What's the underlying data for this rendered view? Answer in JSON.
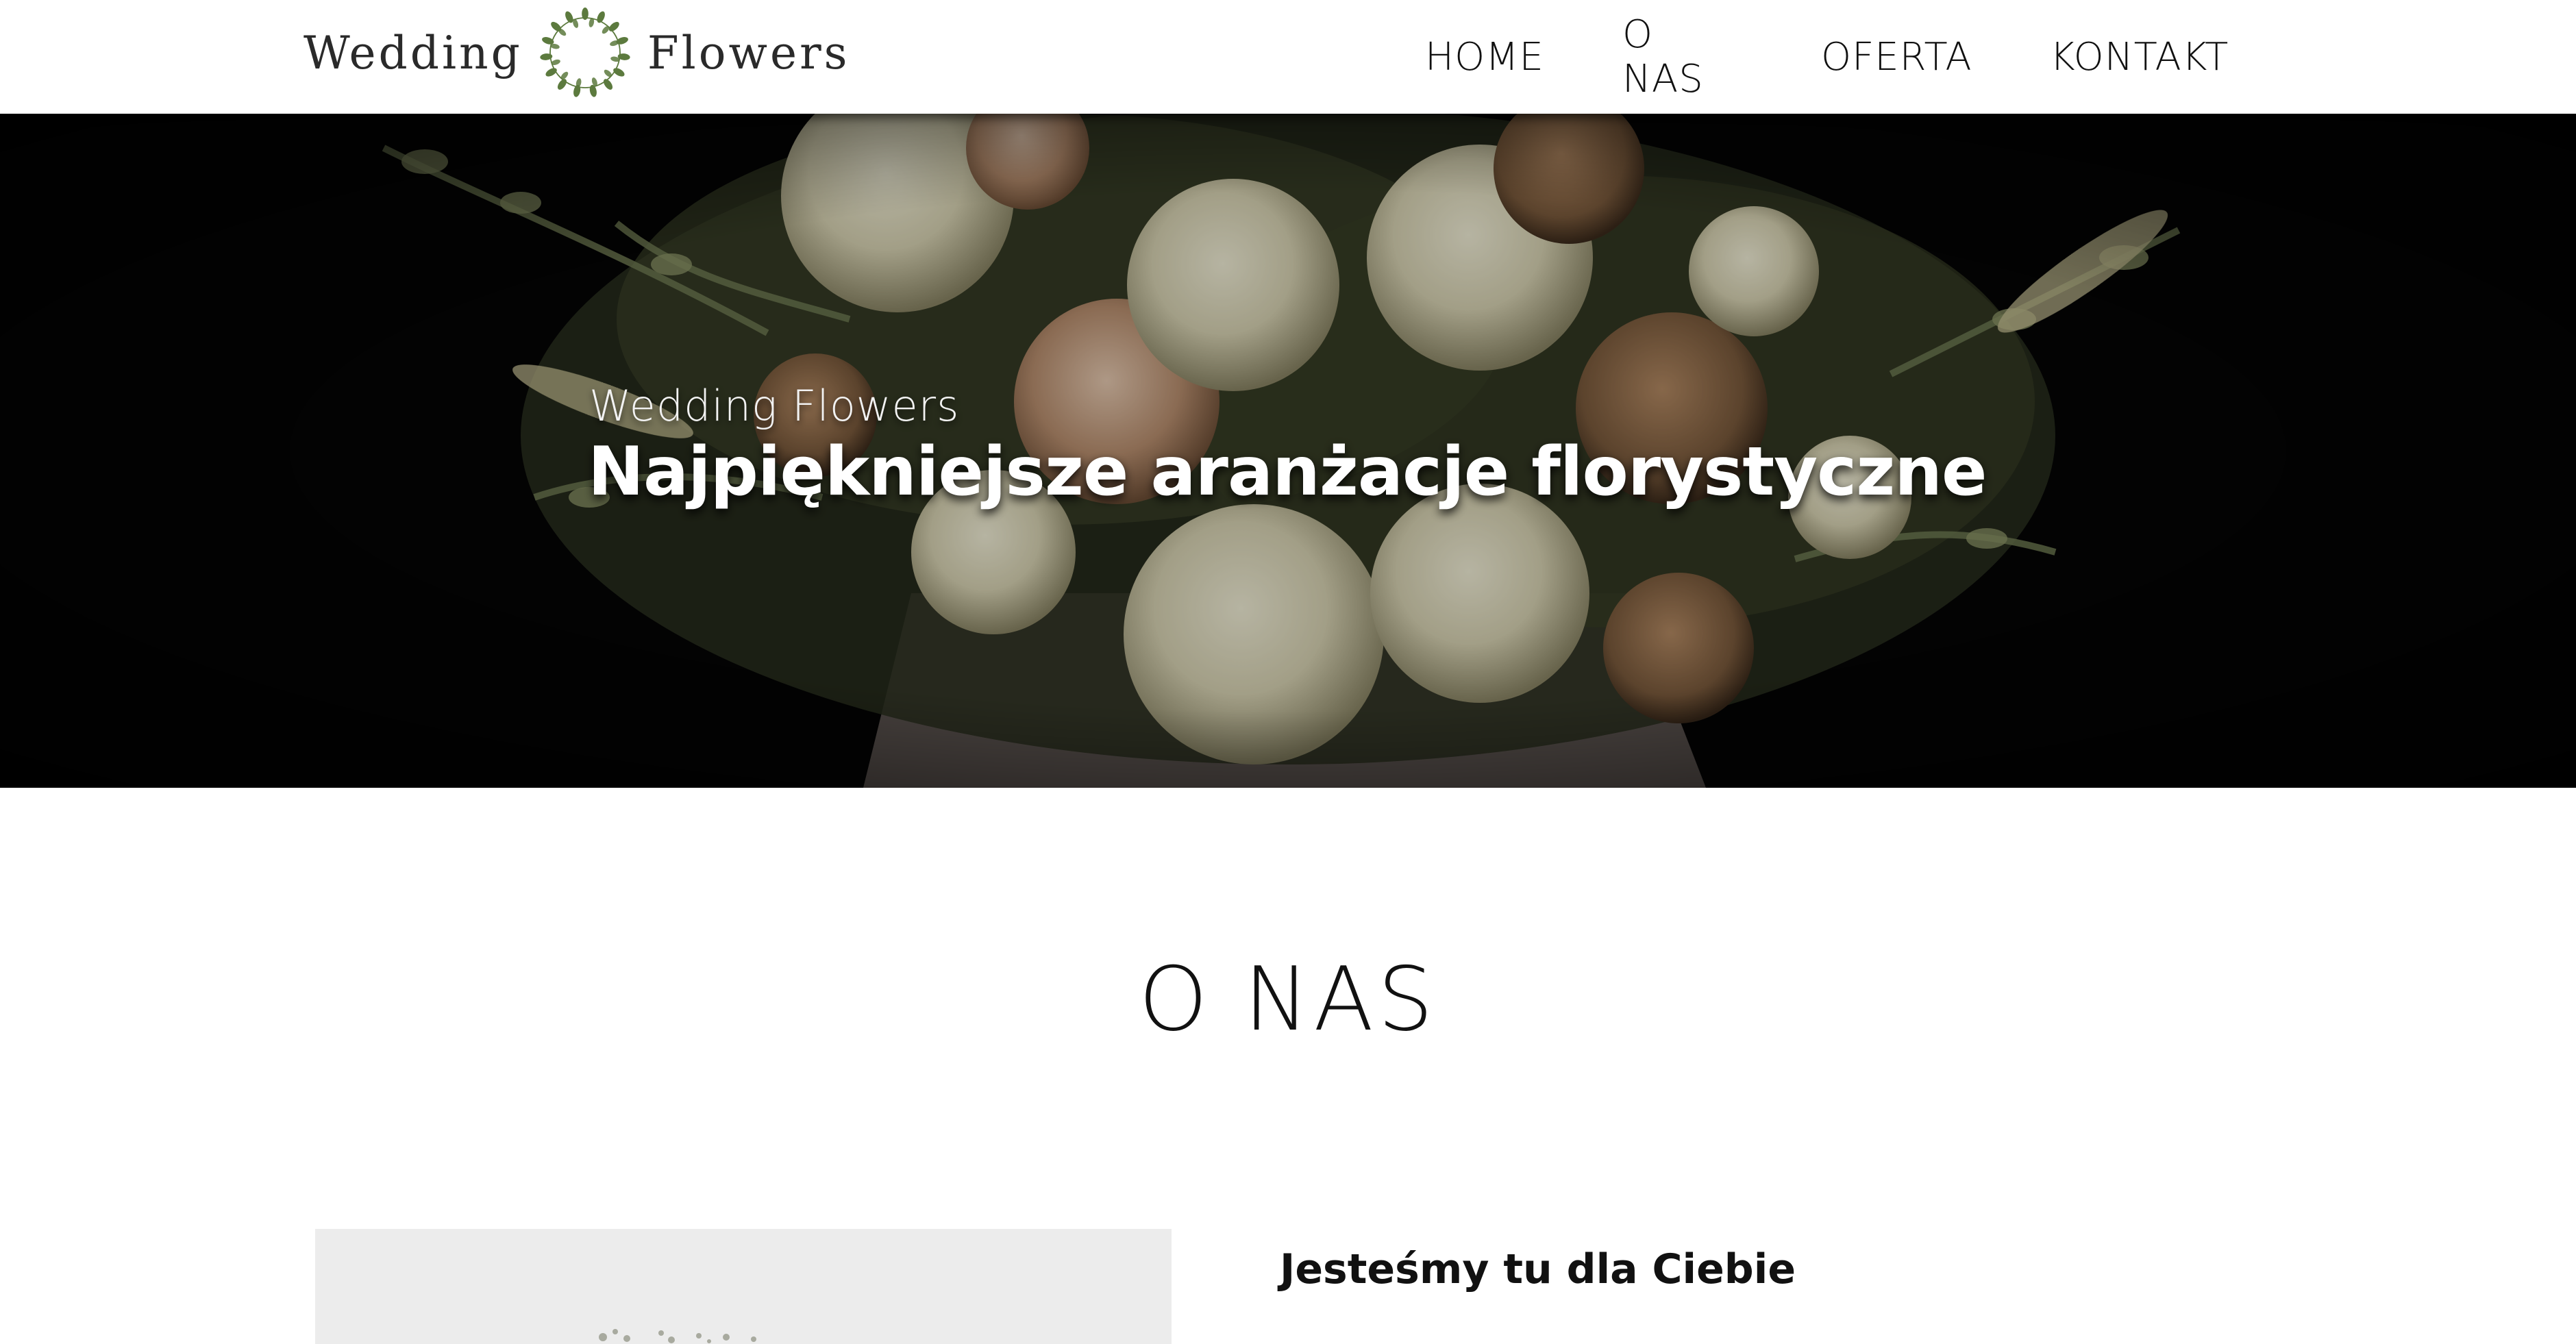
{
  "header": {
    "logo": {
      "word_left": "Wedding",
      "word_right": "Flowers"
    },
    "nav": [
      {
        "label": "HOME"
      },
      {
        "label": "O NAS"
      },
      {
        "label": "OFERTA"
      },
      {
        "label": "KONTAKT"
      }
    ]
  },
  "hero": {
    "eyebrow": "Wedding Flowers",
    "title": "Najpiękniejsze aranżacje florystyczne"
  },
  "about": {
    "title": "O NAS",
    "heading": "Jesteśmy tu dla Ciebie"
  },
  "colors": {
    "leaf_green": "#5c7a3e",
    "text_dark": "#111111",
    "hero_background": "#050505"
  },
  "icons": {
    "logo_mark": "laurel-wreath-icon"
  }
}
